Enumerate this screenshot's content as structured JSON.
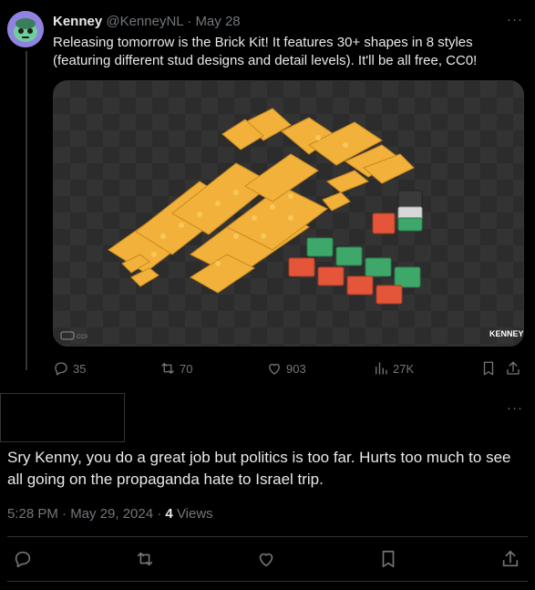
{
  "original_tweet": {
    "author_name": "Kenney",
    "author_handle": "@KenneyNL",
    "separator": "·",
    "date": "May 28",
    "text": "Releasing tomorrow is the Brick Kit! It features 30+ shapes in 8 styles (featuring different stud designs and detail levels). It'll be all free, CC0!",
    "media": {
      "watermark": "KENNEY",
      "license_badge": "CC0"
    },
    "actions": {
      "replies": "35",
      "retweets": "70",
      "likes": "903",
      "views": "27K"
    }
  },
  "reply": {
    "text": "Sry Kenny, you do a great job but politics is too far. Hurts too much to see all going on the propaganda hate to Israel trip.",
    "time": "5:28 PM · May 29, 2024 ·",
    "views_count": "4",
    "views_label": "Views"
  },
  "more_label": "···",
  "icons": [
    "reply-icon",
    "retweet-icon",
    "like-icon",
    "views-icon",
    "bookmark-icon",
    "share-icon"
  ],
  "colors": {
    "background": "#000000",
    "text": "#e7e9ea",
    "muted": "#71767b",
    "brick_yellow": "#f2b13a",
    "brick_red": "#e4553a",
    "brick_green": "#3ea86a"
  }
}
